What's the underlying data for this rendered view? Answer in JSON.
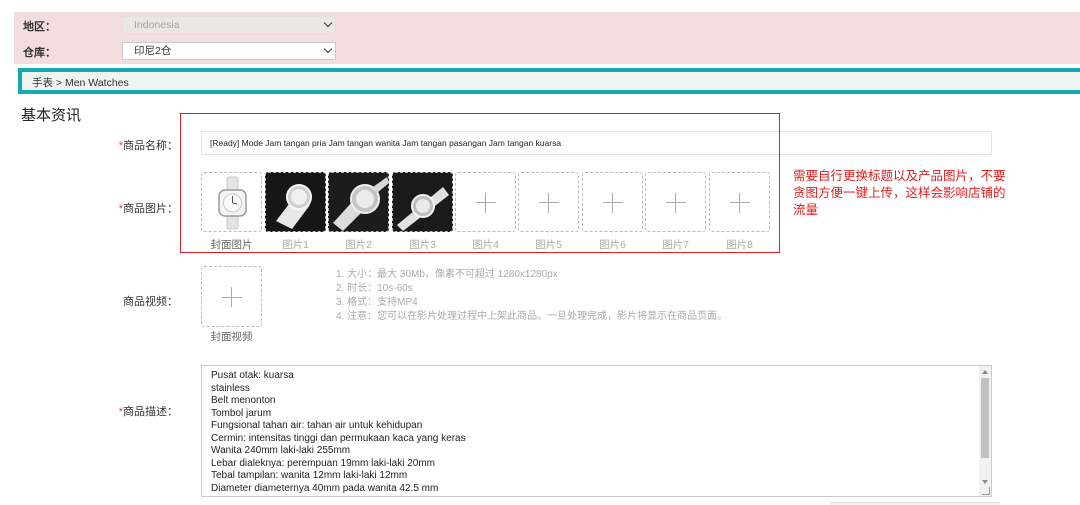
{
  "region": {
    "label": "地区：",
    "value": "Indonesia"
  },
  "warehouse": {
    "label": "仓库：",
    "value": "印尼2仓"
  },
  "breadcrumb": "手表 > Men Watches",
  "section_title": "基本资讯",
  "product_name": {
    "required_mark": "*",
    "label": "商品名称：",
    "value": "[Ready] Mode Jam tangan pria Jam tangan wanita Jam tangan pasangan Jam tangan kuarsa"
  },
  "product_images": {
    "required_mark": "*",
    "label": "商品图片：",
    "captions": [
      "封面图片",
      "图片1",
      "图片2",
      "图片3",
      "图片4",
      "图片5",
      "图片6",
      "图片7",
      "图片8"
    ]
  },
  "annotation": "需要自行更换标题以及产品图片，不要贪图方便一键上传，这样会影响店铺的流量",
  "video": {
    "label": "商品视频：",
    "caption": "封面视频",
    "hints": [
      "1. 大小：最大 30Mb，像素不可超过 1280x1280px",
      "2. 时长：10s-60s",
      "3. 格式：支持MP4",
      "4. 注意：您可以在影片处理过程中上架此商品。一旦处理完成，影片将显示在商品页面。"
    ]
  },
  "description": {
    "required_mark": "*",
    "label": "商品描述：",
    "lines": [
      "Pusat otak: kuarsa",
      "stainless",
      "Belt menonton",
      "Tombol jarum",
      "Fungsional tahan air: tahan air untuk kehidupan",
      "Cermin: intensitas tinggi dan permukaan kaca yang keras",
      "Wanita 240mm laki-laki 255mm",
      "Lebar dialeknya: perempuan 19mm laki-laki 20mm",
      "Tebal tampilan: wanita 12mm laki-laki 12mm",
      "Diameter diameternya 40mm pada wanita 42.5 mm"
    ]
  },
  "colors": {
    "accent": "#17a9b3",
    "annotation": "#e02020",
    "required": "#e4393c",
    "region_bg": "#f2dede"
  }
}
